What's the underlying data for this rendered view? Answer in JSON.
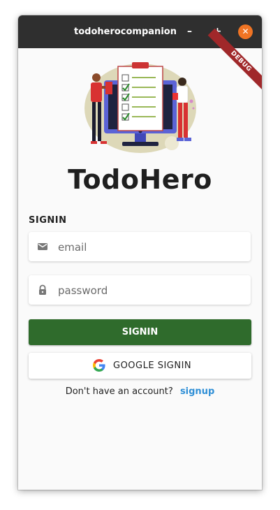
{
  "window": {
    "title": "todoherocompanion",
    "minimize_glyph": "–",
    "maximize_glyph": "+",
    "close_glyph": "✕",
    "close_color": "#f07424"
  },
  "banner": {
    "debug_label": "DEBUG"
  },
  "brand": {
    "app_name": "TodoHero",
    "illustration_icon": "todo-illustration-icon"
  },
  "form": {
    "section_label": "SIGNIN",
    "email": {
      "icon": "mail-icon",
      "placeholder": "email",
      "value": ""
    },
    "password": {
      "icon": "lock-icon",
      "placeholder": "password",
      "value": ""
    },
    "signin_label": "SIGNIN",
    "google_signin_label": "GOOGLE SIGNIN",
    "google_icon": "google-icon"
  },
  "signup": {
    "prompt": "Don't have an account?",
    "link_label": "signup"
  },
  "colors": {
    "primary": "#2f6b2c",
    "link": "#2f8fd6",
    "titlebar": "#2f2f2f",
    "debug_banner": "#a0282a"
  }
}
